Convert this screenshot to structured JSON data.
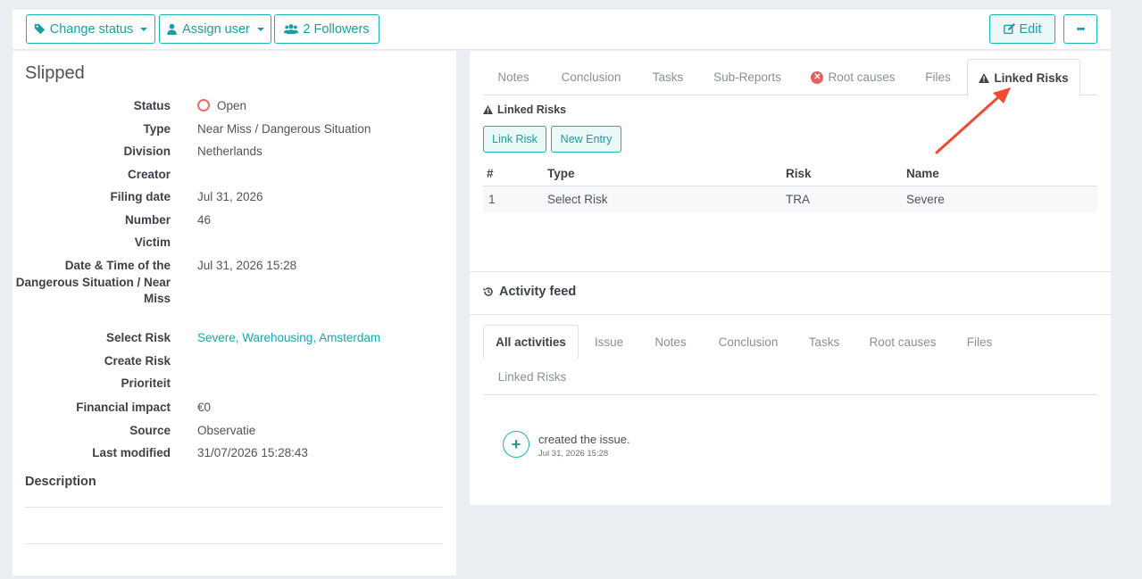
{
  "toolbar": {
    "change_status": "Change status",
    "assign_user": "Assign user",
    "followers": "2 Followers",
    "edit": "Edit",
    "more": "•••"
  },
  "report": {
    "title": "Slipped",
    "fields": [
      {
        "label": "Status",
        "value": "Open"
      },
      {
        "label": "Type",
        "value": "Near Miss / Dangerous Situation"
      },
      {
        "label": "Division",
        "value": "Netherlands"
      },
      {
        "label": "Creator",
        "value": ""
      },
      {
        "label": "Filing date",
        "value": "Jul 31, 2026"
      },
      {
        "label": "Number",
        "value": "46"
      },
      {
        "label": "Victim",
        "value": ""
      },
      {
        "label": "Date & Time of the Dangerous Situation / Near Miss",
        "value": "Jul 31, 2026 15:28"
      },
      {
        "label": "Select Risk",
        "value": "Severe, Warehousing, Amsterdam"
      },
      {
        "label": "Create Risk",
        "value": ""
      },
      {
        "label": "Prioriteit",
        "value": ""
      },
      {
        "label": "Financial impact",
        "value": "€0"
      },
      {
        "label": "Source",
        "value": "Observatie"
      },
      {
        "label": "Last modified",
        "value": "31/07/2026 15:28:43"
      }
    ],
    "description_label": "Description"
  },
  "detail_tabs": [
    "Notes",
    "Conclusion",
    "Tasks",
    "Sub-Reports",
    "Root causes",
    "Files",
    "Linked Risks"
  ],
  "linked_risks": {
    "title": "Linked Risks",
    "link_risk": "Link Risk",
    "new_entry": "New Entry",
    "columns": [
      "#",
      "Type",
      "Risk",
      "Name"
    ],
    "rows": [
      [
        "1",
        "Select Risk",
        "TRA",
        "Severe"
      ]
    ]
  },
  "activity": {
    "title": "Activity feed",
    "tabs": [
      "All activities",
      "Issue",
      "Notes",
      "Conclusion",
      "Tasks",
      "Root causes",
      "Files",
      "Linked Risks"
    ],
    "items": [
      {
        "text": "created the issue.",
        "time": "Jul 31, 2026 15:28"
      }
    ]
  },
  "colors": {
    "accent": "#1ab3b3",
    "status_open": "#ef6b6b",
    "root_cause_icon": "#e46060",
    "annotation_arrow": "#f04a32"
  }
}
